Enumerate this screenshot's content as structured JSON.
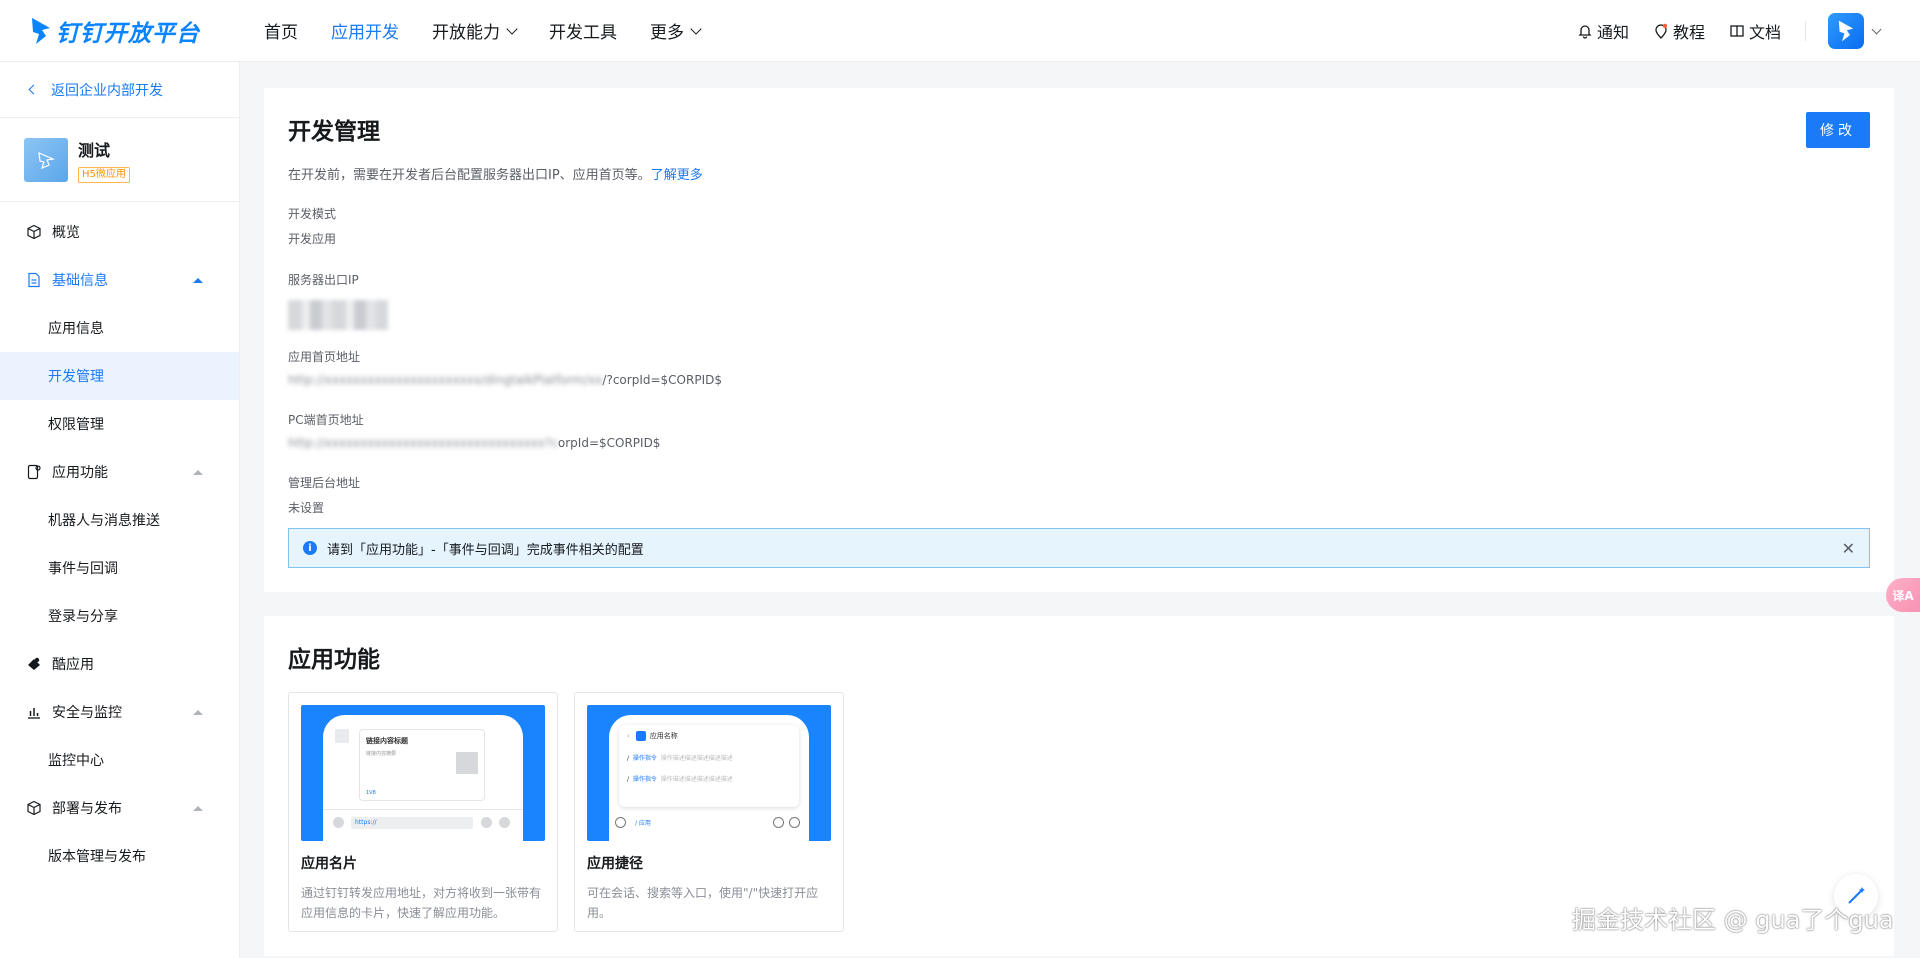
{
  "brand": {
    "name": "钉钉开放平台",
    "color": "#1a7af8"
  },
  "nav": {
    "items": [
      {
        "label": "首页",
        "active": false,
        "dropdown": false
      },
      {
        "label": "应用开发",
        "active": true,
        "dropdown": false
      },
      {
        "label": "开放能力",
        "active": false,
        "dropdown": true
      },
      {
        "label": "开发工具",
        "active": false,
        "dropdown": false
      },
      {
        "label": "更多",
        "active": false,
        "dropdown": true
      }
    ],
    "notify": "通知",
    "tutorial": "教程",
    "docs": "文档"
  },
  "sidebar": {
    "back": "返回企业内部开发",
    "app": {
      "name": "测试",
      "tag": "H5微应用"
    },
    "menu": {
      "overview": "概览",
      "basic": "基础信息",
      "basic_items": [
        "应用信息",
        "开发管理",
        "权限管理"
      ],
      "features": "应用功能",
      "feature_items": [
        "机器人与消息推送",
        "事件与回调",
        "登录与分享"
      ],
      "cool_app": "酷应用",
      "security": "安全与监控",
      "security_items": [
        "监控中心"
      ],
      "deploy": "部署与发布",
      "deploy_items": [
        "版本管理与发布"
      ]
    }
  },
  "dev": {
    "title": "开发管理",
    "edit": "修改",
    "desc": "在开发前，需要在开发者后台配置服务器出口IP、应用首页等。",
    "learn_more": "了解更多",
    "mode_label": "开发模式",
    "mode_value": "开发应用",
    "ip_label": "服务器出口IP",
    "home_label": "应用首页地址",
    "home_blur": "http://xxxxxxxxxxxxxxxxxxxxxx/dingtalkPlatform/xx",
    "home_suffix": "/?corpId=$CORPID$",
    "pc_label": "PC端首页地址",
    "pc_blur": "http://xxxxxxxxxxxxxxxxxxxxxxxxxxxxxxx?c",
    "pc_suffix": "orpId=$CORPID$",
    "admin_label": "管理后台地址",
    "admin_value": "未设置",
    "alert": "请到「应用功能」-「事件与回调」完成事件相关的配置"
  },
  "features": {
    "title": "应用功能",
    "cards": [
      {
        "title": "应用名片",
        "desc": "通过钉钉转发应用地址，对方将收到一张带有应用信息的卡片，快速了解应用功能。",
        "mock_title": "链接内容标题",
        "mock_sub": "链接内容摘要",
        "mock_brand": "1V8",
        "mock_input": "https://"
      },
      {
        "title": "应用捷径",
        "desc": "可在会话、搜索等入口，使用\"/\"快速打开应用。",
        "mock_app": "应用名称",
        "mock_cmd1": "操作指令",
        "mock_cmd2": "操作指令",
        "mock_detail": "操作描述描述描述描述描述",
        "mock_input": "/ 应用"
      }
    ]
  },
  "float": {
    "translate": "译A"
  },
  "watermark": "掘金技术社区 @ gua了个gua"
}
